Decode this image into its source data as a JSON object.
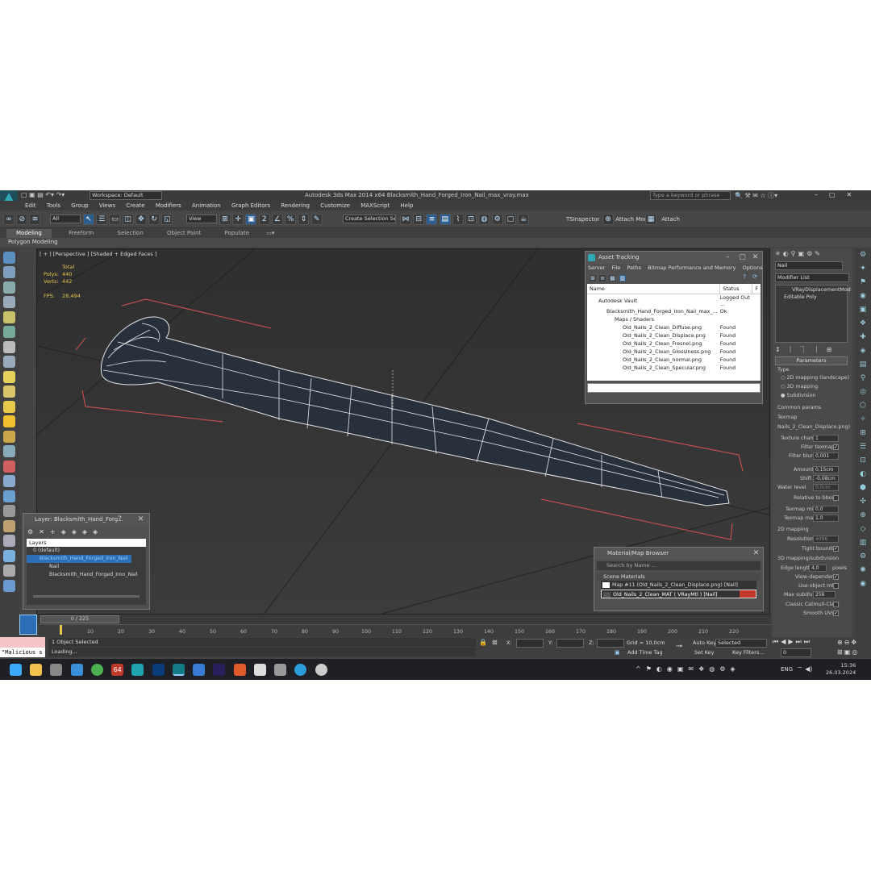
{
  "app": {
    "title": "Autodesk 3ds Max  2014 x64    Blacksmith_Hand_Forged_Iron_Nail_max_vray.max",
    "workspace": "Workspace: Default",
    "search_placeholder": "Type a keyword or phrase"
  },
  "menu": [
    "Edit",
    "Tools",
    "Group",
    "Views",
    "Create",
    "Modifiers",
    "Animation",
    "Graph Editors",
    "Rendering",
    "Customize",
    "MAXScript",
    "Help"
  ],
  "toolbar": {
    "filter": "All",
    "ref_coord": "View",
    "selection_set": "Create Selection Se",
    "tsinspector": "TSInspector",
    "attach_mode": "Attach Mode",
    "attach": "Attach"
  },
  "ribbon": {
    "tabs": [
      "Modeling",
      "Freeform",
      "Selection",
      "Object Paint",
      "Populate"
    ],
    "active_tab": "Modeling",
    "sub": "Polygon Modeling"
  },
  "viewport": {
    "label": "[ + ] [Perspective ] [Shaded + Edged Faces ]",
    "stats_header": "Total",
    "polys_label": "Polys:",
    "polys": "440",
    "verts_label": "Verts:",
    "verts": "442",
    "fps_label": "FPS:",
    "fps": "28,494"
  },
  "asset_tracking": {
    "title": "Asset Tracking",
    "menu": [
      "Server",
      "File",
      "Paths",
      "Bitmap Performance and Memory",
      "Options"
    ],
    "columns": [
      "Name",
      "Status",
      "F"
    ],
    "rows": [
      {
        "name": "Autodesk Vault",
        "status": "Logged Out ..."
      },
      {
        "name": "Blacksmith_Hand_Forged_Iron_Nail_max_...",
        "status": "Ok"
      },
      {
        "name": "Maps / Shaders",
        "status": ""
      },
      {
        "name": "Old_Nails_2_Clean_Diffuse.png",
        "status": "Found"
      },
      {
        "name": "Old_Nails_2_Clean_Displace.png",
        "status": "Found"
      },
      {
        "name": "Old_Nails_2_Clean_Fresnel.png",
        "status": "Found"
      },
      {
        "name": "Old_Nails_2_Clean_Glossiness.png",
        "status": "Found"
      },
      {
        "name": "Old_Nails_2_Clean_normal.png",
        "status": "Found"
      },
      {
        "name": "Old_Nails_2_Clean_Specular.png",
        "status": "Found"
      }
    ]
  },
  "layer_panel": {
    "title": "Layer: Blacksmith_Hand_Forg...",
    "help": "?",
    "header": "Layers",
    "items": [
      "0 (default)",
      "Blacksmith_Hand_Forged_Iron_Nail",
      "Nail",
      "Blacksmith_Hand_Forged_Iron_Nail"
    ]
  },
  "material_browser": {
    "title": "Material/Map Browser",
    "search_placeholder": "Search by Name ...",
    "section": "Scene Materials",
    "items": [
      "Map #11 (Old_Nails_2_Clean_Displace.png) [Nail]",
      "Old_Nails_2_Clean_MAT  ( VRayMtl ) [Nail]"
    ]
  },
  "command_panel": {
    "object_name": "Nail",
    "modifier_list": "Modifier List",
    "stack": [
      "VRayDisplacementMod",
      "Editable Poly"
    ],
    "rollout": "Parameters",
    "type_label": "Type",
    "types": [
      "2D mapping (landscape)",
      "3D mapping",
      "Subdivision"
    ],
    "common_params": "Common params",
    "texmap_label": "Texmap",
    "texmap": "Nails_2_Clean_Displace.png)",
    "texture_chan_label": "Texture chan",
    "texture_chan": "1",
    "filter_texmap": "Filter texmap",
    "filter_blur_label": "Filter blur",
    "filter_blur": "0,001",
    "amount_label": "Amount",
    "amount": "0,15cm",
    "shift_label": "Shift",
    "shift": "-0,08cm",
    "water_level_label": "Water level",
    "water_level": "0,0cm",
    "relative_bbox": "Relative to bbox",
    "texmap_min_label": "Texmap min",
    "texmap_min": "0,0",
    "texmap_max_label": "Texmap max",
    "texmap_max": "1,0",
    "mapping_2d": "2D mapping",
    "resolution_label": "Resolution",
    "resolution": "4096",
    "tight_bounds": "Tight bounds",
    "subdiv_3d": "3D mapping/subdivision",
    "edge_length_label": "Edge length",
    "edge_length": "4,0",
    "pixels": "pixels",
    "view_dependent": "View-dependent",
    "use_object_mtl": "Use object mtl",
    "max_subdivs_label": "Max subdivs",
    "max_subdivs": "256",
    "classic_catmull": "Classic Catmull-Clark",
    "smooth_uvs": "Smooth UVs"
  },
  "timeline": {
    "frame": "0 / 225",
    "ticks": [
      "10",
      "20",
      "30",
      "40",
      "50",
      "60",
      "70",
      "80",
      "90",
      "100",
      "110",
      "120",
      "130",
      "140",
      "150",
      "160",
      "170",
      "180",
      "190",
      "200",
      "210",
      "220"
    ]
  },
  "status": {
    "script": "\"Malicious s",
    "selected": "1 Object Selected",
    "loading": "Loading...",
    "x_label": "X:",
    "y_label": "Y:",
    "z_label": "Z:",
    "grid": "Grid = 10,0cm",
    "add_time_tag": "Add Time Tag",
    "auto_key": "Auto Key",
    "selected_mode": "Selected",
    "set_key": "Set Key",
    "key_filters": "Key Filters...",
    "frame": "0"
  },
  "taskbar": {
    "lang": "ENG",
    "time": "15:36",
    "date": "26.03.2024",
    "app_badge": "64"
  },
  "colors": {
    "accent": "#2c6fb6",
    "viewport_bg": "#3a3a3a",
    "selection_red": "#d9534f"
  }
}
